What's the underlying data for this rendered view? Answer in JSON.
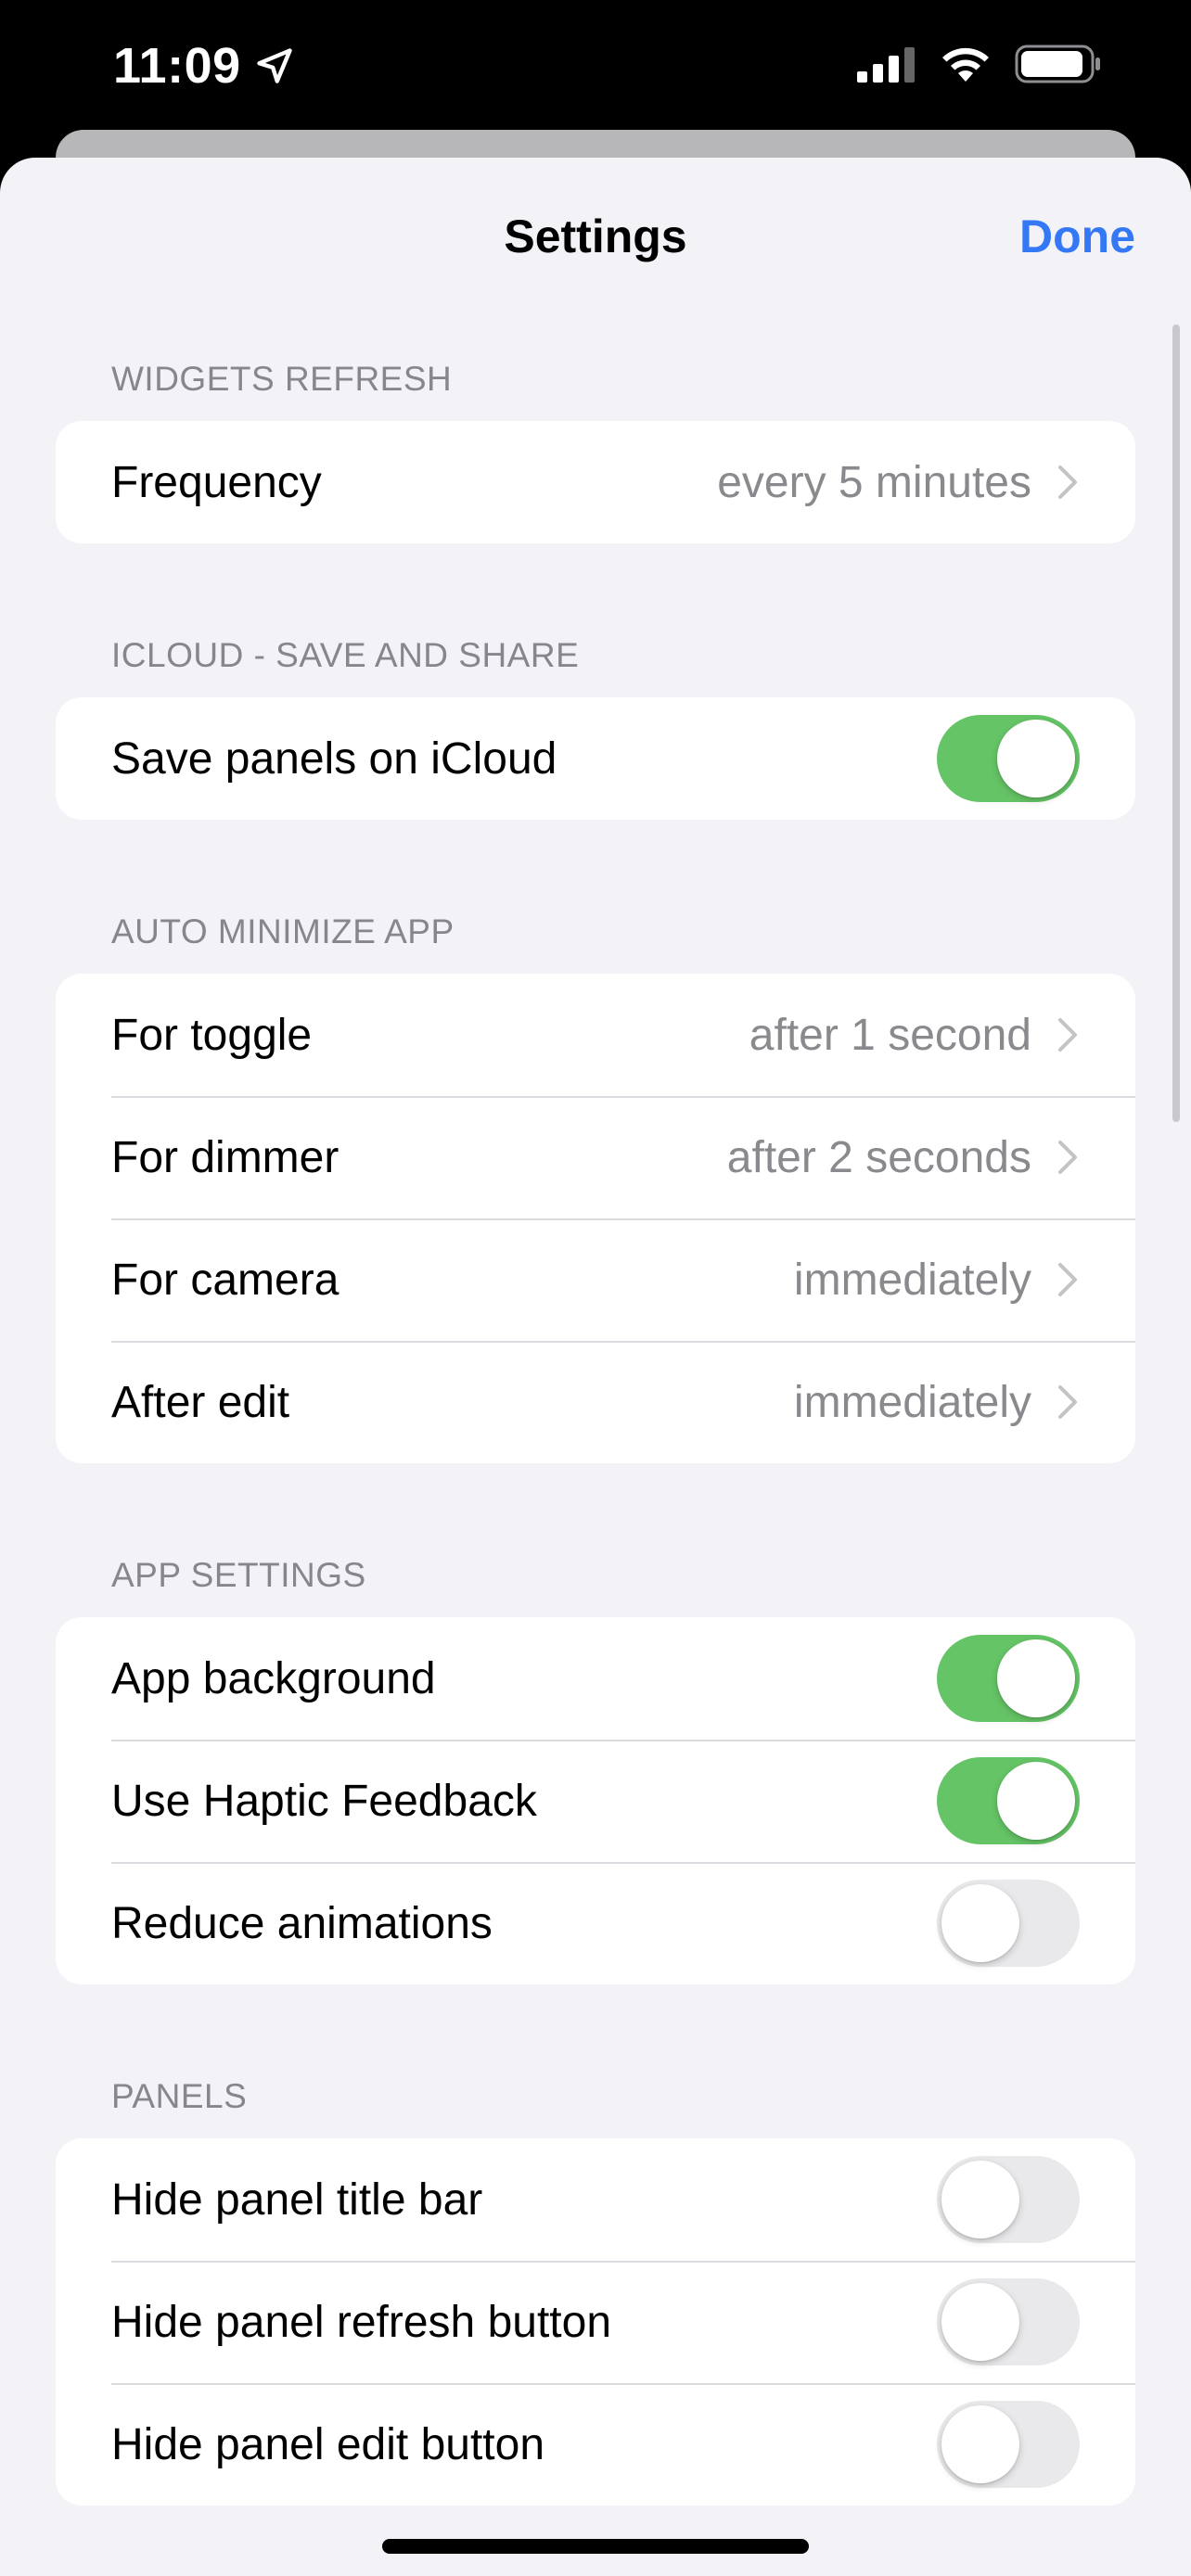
{
  "status": {
    "time": "11:09"
  },
  "nav": {
    "title": "Settings",
    "done_label": "Done"
  },
  "sections": {
    "widgets": {
      "header": "WIDGETS REFRESH",
      "frequency": {
        "label": "Frequency",
        "value": "every 5 minutes"
      }
    },
    "icloud": {
      "header": "ICLOUD - SAVE AND SHARE",
      "save_panels": {
        "label": "Save panels on iCloud",
        "on": true
      }
    },
    "auto_minimize": {
      "header": "AUTO MINIMIZE APP",
      "toggle": {
        "label": "For toggle",
        "value": "after 1 second"
      },
      "dimmer": {
        "label": "For dimmer",
        "value": "after 2 seconds"
      },
      "camera": {
        "label": "For camera",
        "value": "immediately"
      },
      "edit": {
        "label": "After edit",
        "value": "immediately"
      }
    },
    "app_settings": {
      "header": "APP SETTINGS",
      "background": {
        "label": "App background",
        "on": true
      },
      "haptic": {
        "label": "Use Haptic Feedback",
        "on": true
      },
      "reduce_animations": {
        "label": "Reduce animations",
        "on": false
      }
    },
    "panels": {
      "header": "PANELS",
      "hide_title_bar": {
        "label": "Hide panel title bar",
        "on": false
      },
      "hide_refresh": {
        "label": "Hide panel refresh button",
        "on": false
      },
      "hide_edit": {
        "label": "Hide panel edit button",
        "on": false
      }
    }
  },
  "colors": {
    "accent": "#3478f6",
    "toggle_on": "#65c466",
    "toggle_off": "#e9e9eb",
    "background": "#f2f2f7"
  }
}
